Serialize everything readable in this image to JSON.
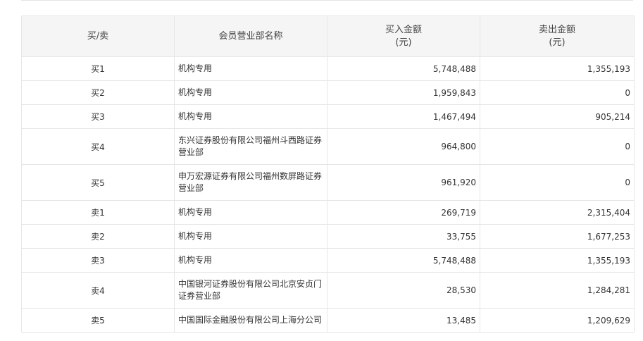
{
  "headers": {
    "direction": "买/卖",
    "member_name": "会员营业部名称",
    "buy_amount_line1": "买入金额",
    "buy_amount_line2": "(元)",
    "sell_amount_line1": "卖出金额",
    "sell_amount_line2": "(元)"
  },
  "rows": [
    {
      "direction": "买1",
      "name": "机构专用",
      "buy": "5,748,488",
      "sell": "1,355,193"
    },
    {
      "direction": "买2",
      "name": "机构专用",
      "buy": "1,959,843",
      "sell": "0"
    },
    {
      "direction": "买3",
      "name": "机构专用",
      "buy": "1,467,494",
      "sell": "905,214"
    },
    {
      "direction": "买4",
      "name": "东兴证券股份有限公司福州斗西路证券营业部",
      "buy": "964,800",
      "sell": "0"
    },
    {
      "direction": "买5",
      "name": "申万宏源证券有限公司福州数屏路证券营业部",
      "buy": "961,920",
      "sell": "0"
    },
    {
      "direction": "卖1",
      "name": "机构专用",
      "buy": "269,719",
      "sell": "2,315,404"
    },
    {
      "direction": "卖2",
      "name": "机构专用",
      "buy": "33,755",
      "sell": "1,677,253"
    },
    {
      "direction": "卖3",
      "name": "机构专用",
      "buy": "5,748,488",
      "sell": "1,355,193"
    },
    {
      "direction": "卖4",
      "name": "中国银河证券股份有限公司北京安贞门证券营业部",
      "buy": "28,530",
      "sell": "1,284,281"
    },
    {
      "direction": "卖5",
      "name": "中国国际金融股份有限公司上海分公司",
      "buy": "13,485",
      "sell": "1,209,629"
    }
  ]
}
